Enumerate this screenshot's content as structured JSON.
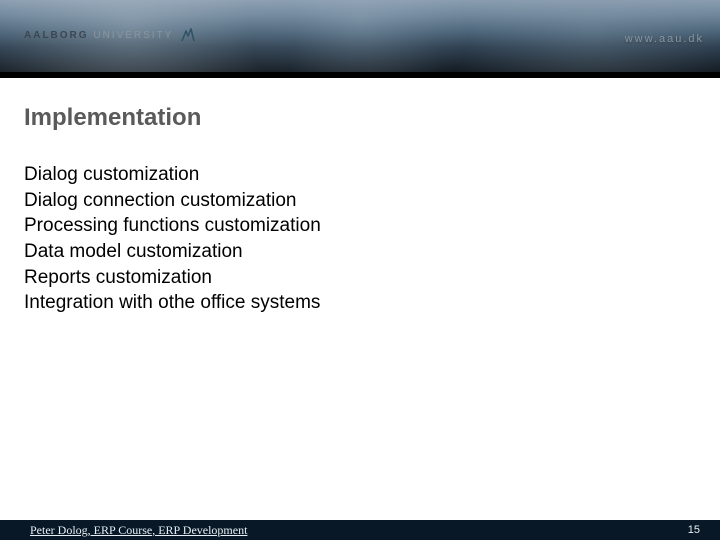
{
  "header": {
    "logo_primary": "AALBORG",
    "logo_secondary": "UNIVERSITY",
    "url": "www.aau.dk"
  },
  "title": "Implementation",
  "bullets": [
    "Dialog customization",
    "Dialog connection customization",
    "Processing functions customization",
    "Data model customization",
    "Reports customization",
    "Integration with othe office systems"
  ],
  "footer": {
    "author_course": "Peter Dolog, ERP Course, ERP Development",
    "page_number": "15"
  }
}
